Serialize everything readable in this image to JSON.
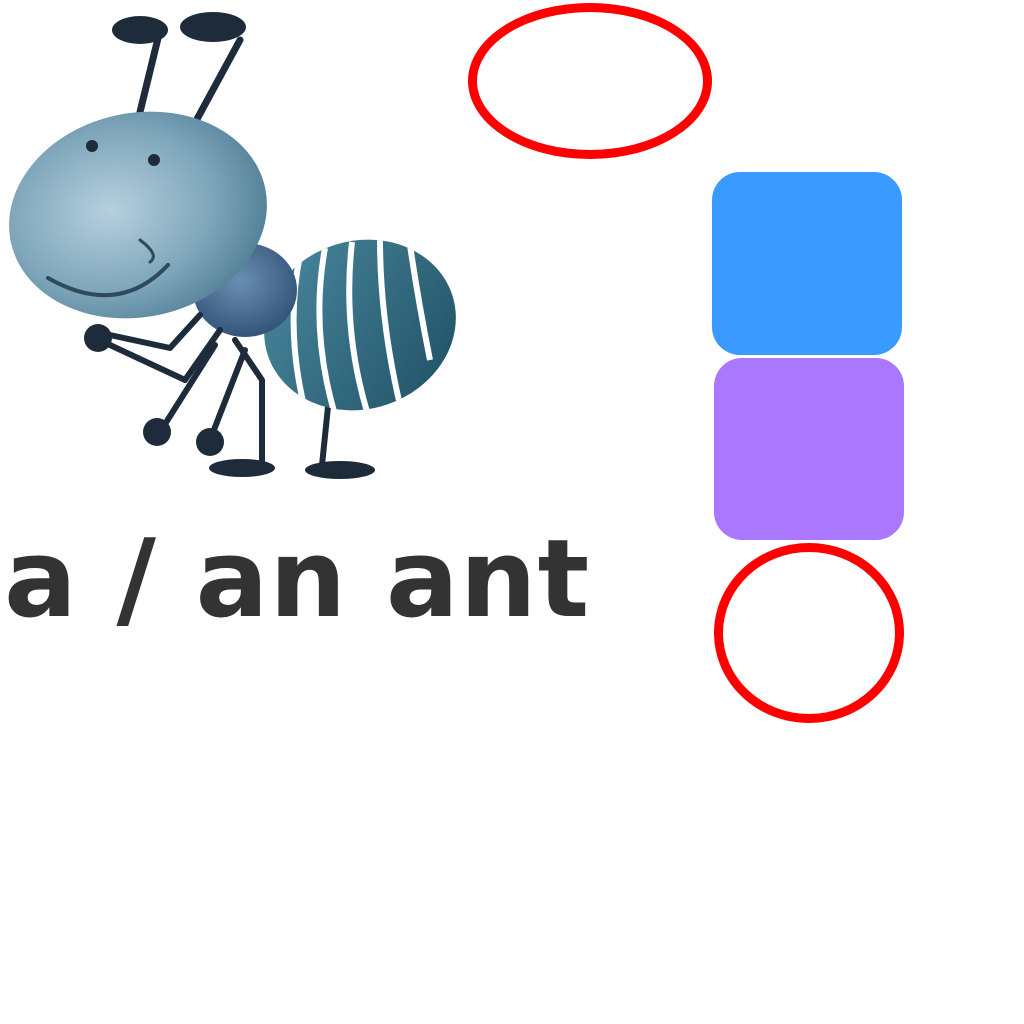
{
  "caption": {
    "text": "a / an ant",
    "color": "#333333"
  },
  "illustration": {
    "subject": "ant-icon"
  },
  "highlights": {
    "color": "#ff0000"
  },
  "option_cards": [
    {
      "color": "#3a9aff"
    },
    {
      "color": "#aa77ff"
    }
  ]
}
